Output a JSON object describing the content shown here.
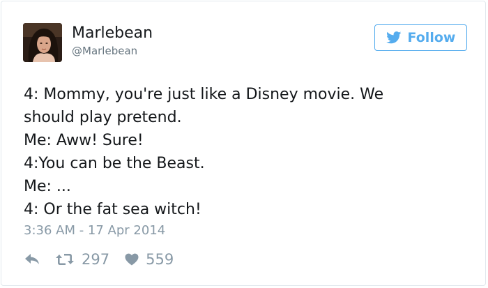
{
  "user": {
    "display_name": "Marlebean",
    "handle": "@Marlebean"
  },
  "follow_button": {
    "label": "Follow",
    "icon": "twitter-bird-icon",
    "color": "#55acee"
  },
  "tweet": {
    "lines": [
      "4: Mommy, you're just like a Disney movie. We",
      "should play pretend.",
      "Me: Aww! Sure!",
      "4:You can be the Beast.",
      "Me: ...",
      "4: Or the fat sea witch!"
    ],
    "timestamp": "3:36 AM - 17 Apr 2014"
  },
  "actions": {
    "reply_icon": "reply-icon",
    "retweet_icon": "retweet-icon",
    "retweet_count": "297",
    "like_icon": "heart-icon",
    "like_count": "559"
  },
  "colors": {
    "text": "#14171a",
    "secondary": "#66757f",
    "muted": "#8899a6",
    "border": "#e1e8ed"
  }
}
